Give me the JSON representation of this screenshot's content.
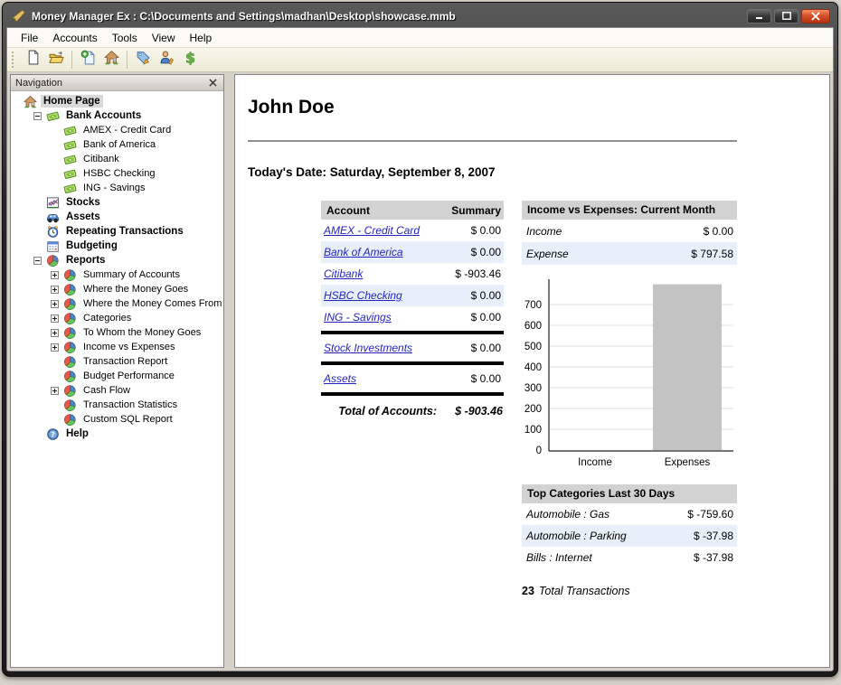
{
  "window": {
    "title": "Money Manager Ex : C:\\Documents and Settings\\madhan\\Desktop\\showcase.mmb",
    "controls": [
      {
        "name": "minimize",
        "icon": "minimize-icon"
      },
      {
        "name": "maximize",
        "icon": "maximize-icon"
      },
      {
        "name": "close",
        "icon": "close-icon"
      }
    ]
  },
  "menu_items": [
    "File",
    "Accounts",
    "Tools",
    "View",
    "Help"
  ],
  "toolbar": {
    "groups": [
      [
        {
          "name": "new-database",
          "icon": "new-file-icon"
        },
        {
          "name": "open-database",
          "icon": "open-folder-icon"
        }
      ],
      [
        {
          "name": "new-account",
          "icon": "new-account-icon"
        },
        {
          "name": "home-page",
          "icon": "home-icon"
        }
      ],
      [
        {
          "name": "organize-categories",
          "icon": "tag-icon"
        },
        {
          "name": "organize-payees",
          "icon": "payee-icon"
        },
        {
          "name": "currency",
          "icon": "dollar-icon"
        }
      ]
    ]
  },
  "navigation": {
    "title": "Navigation",
    "close_icon": "close-icon",
    "tree": [
      {
        "label": "Home Page",
        "level": 0,
        "bold": true,
        "icon": "home-icon",
        "selected": true
      },
      {
        "label": "Bank Accounts",
        "level": 1,
        "bold": true,
        "icon": "money-icon",
        "expander": "minus"
      },
      {
        "label": "AMEX - Credit Card",
        "level": 2,
        "icon": "money-icon"
      },
      {
        "label": "Bank of America",
        "level": 2,
        "icon": "money-icon"
      },
      {
        "label": "Citibank",
        "level": 2,
        "icon": "money-icon"
      },
      {
        "label": "HSBC Checking",
        "level": 2,
        "icon": "money-icon"
      },
      {
        "label": "ING - Savings",
        "level": 2,
        "icon": "money-icon"
      },
      {
        "label": "Stocks",
        "level": 1,
        "bold": true,
        "icon": "stocks-icon"
      },
      {
        "label": "Assets",
        "level": 1,
        "bold": true,
        "icon": "assets-icon"
      },
      {
        "label": "Repeating Transactions",
        "level": 1,
        "bold": true,
        "icon": "clock-icon"
      },
      {
        "label": "Budgeting",
        "level": 1,
        "bold": true,
        "icon": "calendar-icon"
      },
      {
        "label": "Reports",
        "level": 1,
        "bold": true,
        "icon": "pie-chart-icon",
        "expander": "minus"
      },
      {
        "label": "Summary of Accounts",
        "level": 2,
        "icon": "pie-chart-icon",
        "expander": "plus"
      },
      {
        "label": "Where the Money Goes",
        "level": 2,
        "icon": "pie-chart-icon",
        "expander": "plus"
      },
      {
        "label": "Where the Money Comes From",
        "level": 2,
        "icon": "pie-chart-icon",
        "expander": "plus"
      },
      {
        "label": "Categories",
        "level": 2,
        "icon": "pie-chart-icon",
        "expander": "plus"
      },
      {
        "label": "To Whom the Money Goes",
        "level": 2,
        "icon": "pie-chart-icon",
        "expander": "plus"
      },
      {
        "label": "Income vs Expenses",
        "level": 2,
        "icon": "pie-chart-icon",
        "expander": "plus"
      },
      {
        "label": "Transaction Report",
        "level": 2,
        "icon": "pie-chart-icon"
      },
      {
        "label": "Budget Performance",
        "level": 2,
        "icon": "pie-chart-icon"
      },
      {
        "label": "Cash Flow",
        "level": 2,
        "icon": "pie-chart-icon",
        "expander": "plus"
      },
      {
        "label": "Transaction Statistics",
        "level": 2,
        "icon": "pie-chart-icon"
      },
      {
        "label": "Custom SQL Report",
        "level": 2,
        "icon": "pie-chart-icon"
      },
      {
        "label": "Help",
        "level": 1,
        "bold": true,
        "icon": "help-icon"
      }
    ]
  },
  "main": {
    "user_name": "John Doe",
    "date_line": "Today's Date: Saturday, September 8, 2007",
    "accounts_table": {
      "col_account": "Account",
      "col_summary": "Summary",
      "groups": [
        {
          "rows": [
            {
              "label": "AMEX - Credit Card",
              "value": "$ 0.00"
            },
            {
              "label": "Bank of America",
              "value": "$ 0.00"
            },
            {
              "label": "Citibank",
              "value": "$ -903.46"
            },
            {
              "label": "HSBC Checking",
              "value": "$ 0.00"
            },
            {
              "label": "ING - Savings",
              "value": "$ 0.00"
            }
          ]
        },
        {
          "rows": [
            {
              "label": "Stock Investments",
              "value": "$ 0.00"
            }
          ]
        },
        {
          "rows": [
            {
              "label": "Assets",
              "value": "$ 0.00"
            }
          ]
        }
      ],
      "total_label": "Total of Accounts:",
      "total_value": "$ -903.46"
    },
    "income_expenses": {
      "title": "Income vs Expenses: Current Month",
      "rows": [
        {
          "label": "Income",
          "value": "$ 0.00"
        },
        {
          "label": "Expense",
          "value": "$ 797.58"
        }
      ]
    },
    "chart_data": {
      "type": "bar",
      "categories": [
        "Income",
        "Expenses"
      ],
      "values": [
        0,
        797.58
      ],
      "title": "",
      "xlabel": "",
      "ylabel": "",
      "ylim": [
        0,
        800
      ],
      "yticks": [
        0,
        100,
        200,
        300,
        400,
        500,
        600,
        700
      ],
      "grid": true,
      "legend": "none",
      "bar_color": "#c3c3c3"
    },
    "top_categories": {
      "title": "Top Categories Last 30 Days",
      "rows": [
        {
          "label": "Automobile : Gas",
          "value": "$ -759.60"
        },
        {
          "label": "Automobile : Parking",
          "value": "$ -37.98"
        },
        {
          "label": "Bills : Internet",
          "value": "$ -37.98"
        }
      ]
    },
    "transactions_count": "23",
    "transactions_label": "Total Transactions"
  },
  "colors": {
    "link": "#2323c8",
    "row_alt": "#e7f0fa",
    "table_header_bg": "#d2d2d2",
    "bar_fill": "#c3c3c3",
    "close_button": "#d8512a",
    "titlebar": "#262626",
    "toolbar_bg": "#f2efdd"
  }
}
